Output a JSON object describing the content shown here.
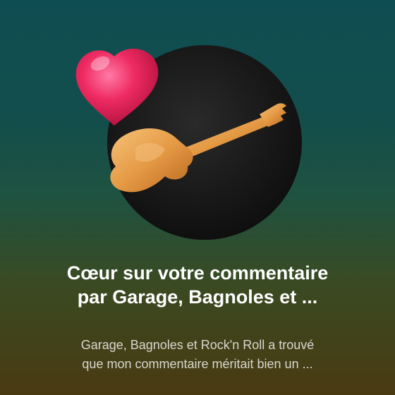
{
  "notification": {
    "title_line1": "Cœur sur votre commentaire",
    "title_line2": "par Garage, Bagnoles et ...",
    "body_line1": "Garage, Bagnoles et Rock'n Roll a trouvé",
    "body_line2": "que mon commentaire méritait bien un ..."
  },
  "artwork": {
    "heart_icon": "heart-icon",
    "guitar_icon": "electric-guitar-icon",
    "avatar_background": "#1a1a1a",
    "heart_color": "#e8245c",
    "guitar_color": "#e0a050"
  }
}
